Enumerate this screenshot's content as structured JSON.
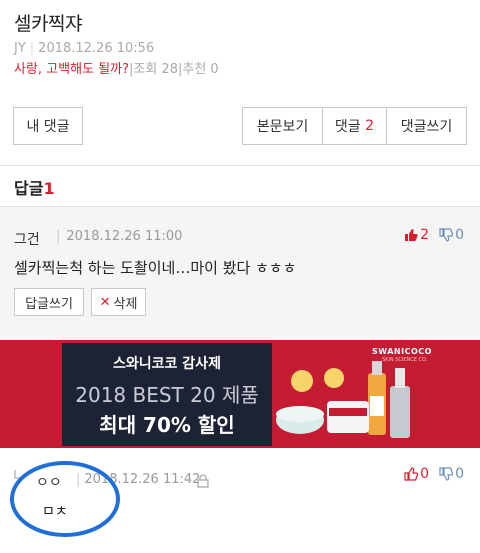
{
  "post": {
    "title": "셀카찍쟈",
    "author": "JY",
    "date": "2018.12.26 10:56",
    "category": "사랑, 고백해도 될까?",
    "views": "조회 28",
    "recommend": "추천 0"
  },
  "actions": {
    "my_comments": "내 댓글",
    "view_post": "본문보기",
    "comments_label": "댓글",
    "comments_count": "2",
    "write_comment": "댓글쓰기"
  },
  "replies": {
    "heading": "답글",
    "count": "1"
  },
  "comments": [
    {
      "author": "그건",
      "date": "2018.12.26 11:00",
      "body": "셀카찍는척 하는 도촬이네…마이 봤다 ㅎㅎㅎ",
      "likes": "2",
      "dislikes": "0",
      "reply_label": "답글쓰기",
      "delete_label": "삭제"
    },
    {
      "author": "ㅇㅇ",
      "date": "2018.12.26 11:42",
      "body": "ㅁㅊ",
      "likes": "0",
      "dislikes": "0"
    }
  ],
  "banner": {
    "line1": "스와니코코 감사제",
    "line2": "2018 BEST 20 제품",
    "line3": "최대 70% 할인",
    "brand": "SWANICOCO",
    "brand_sub": "SKIN SCIENCE CO."
  },
  "colors": {
    "accent": "#d91e2e",
    "banner_bg": "#c41d33",
    "banner_box": "#1d2334",
    "annotation_circle": "#1f6fd6"
  }
}
